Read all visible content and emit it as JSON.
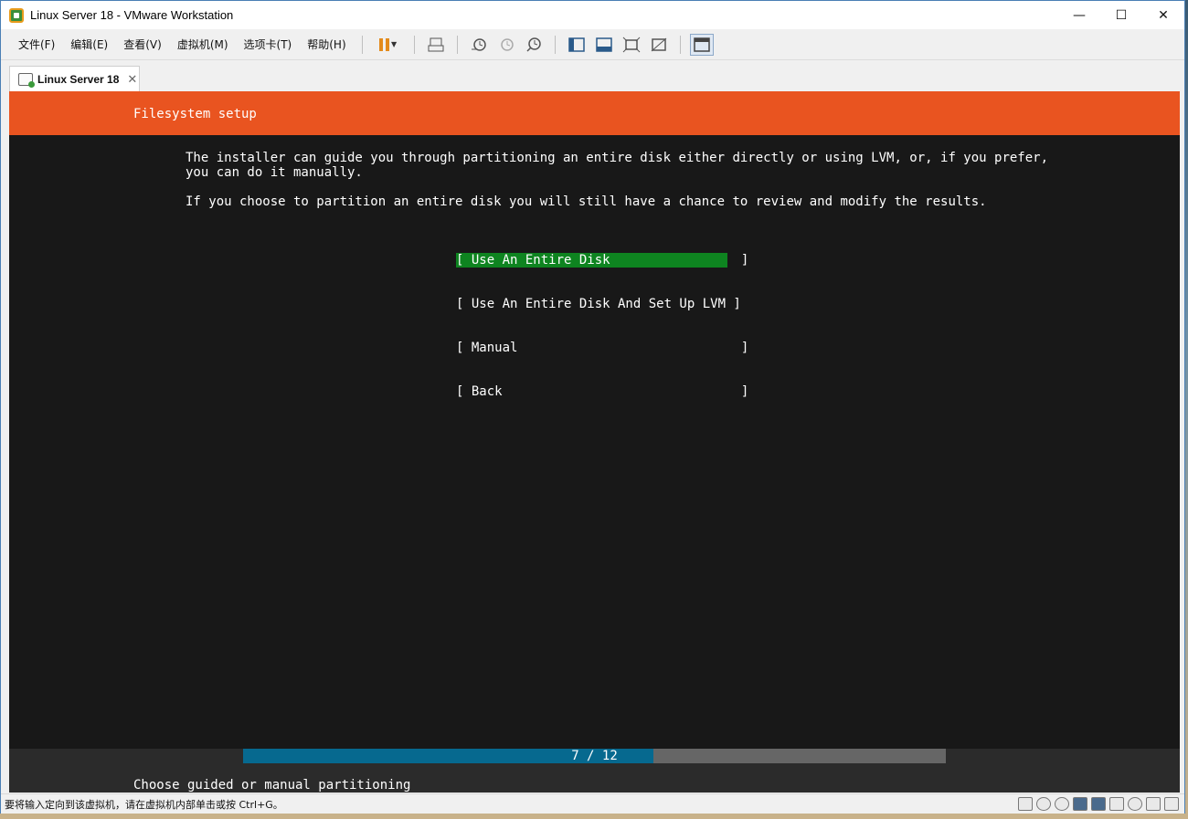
{
  "window": {
    "title": "Linux Server 18 - VMware Workstation"
  },
  "menu": [
    "文件(F)",
    "编辑(E)",
    "查看(V)",
    "虚拟机(M)",
    "选项卡(T)",
    "帮助(H)"
  ],
  "tab": {
    "label": "Linux Server 18"
  },
  "installer": {
    "header": "Filesystem setup",
    "paragraph1_line1": "The installer can guide you through partitioning an entire disk either directly or using LVM, or, if you prefer,",
    "paragraph1_line2": "you can do it manually.",
    "paragraph2": "If you choose to partition an entire disk you will still have a chance to review and modify the results.",
    "choices": [
      "[ Use An Entire Disk                 ]",
      "[ Use An Entire Disk And Set Up LVM ]",
      "[ Manual                             ]",
      "[ Back                               ]"
    ],
    "selected_index": 0,
    "progress": {
      "text": "7 / 12",
      "current": 7,
      "total": 12
    },
    "hint": "Choose guided or manual partitioning"
  },
  "status": {
    "message": "要将输入定向到该虚拟机，请在虚拟机内部单击或按 Ctrl+G。"
  },
  "colors": {
    "ubuntu_orange": "#e95420",
    "selected_green": "#0e8420",
    "progress_blue": "#06698f"
  }
}
